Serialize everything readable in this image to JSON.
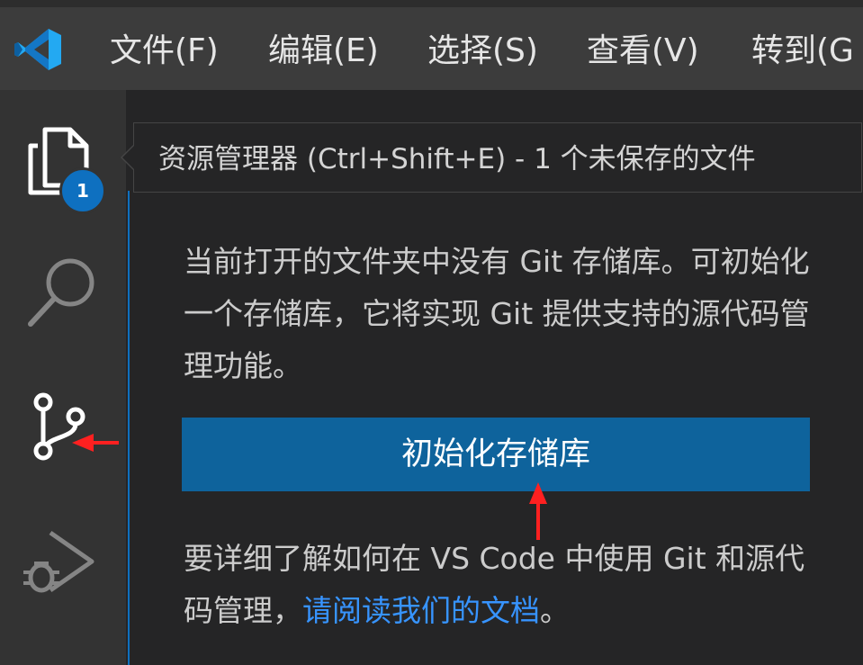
{
  "menu": {
    "items": [
      {
        "label": "文件(F)"
      },
      {
        "label": "编辑(E)"
      },
      {
        "label": "选择(S)"
      },
      {
        "label": "查看(V)"
      },
      {
        "label": "转到(G"
      }
    ]
  },
  "activity_bar": {
    "explorer_badge": "1",
    "icons": [
      "files-icon",
      "search-icon",
      "source-control-icon",
      "run-debug-icon"
    ]
  },
  "tooltip": {
    "text": "资源管理器 (Ctrl+Shift+E) - 1 个未保存的文件"
  },
  "source_control": {
    "message": "当前打开的文件夹中没有 Git 存储库。可初始化一个存储库，它将实现 Git 提供支持的源代码管理功能。",
    "init_button": "初始化存储库",
    "footer_text": "要详细了解如何在 VS Code 中使用 Git 和源代码管理，",
    "footer_link": "请阅读我们的文档",
    "footer_end": "。"
  },
  "colors": {
    "accent": "#0e639c",
    "badge": "#0e70c0",
    "link": "#3794ff",
    "annotation_arrow": "#ff2020"
  }
}
